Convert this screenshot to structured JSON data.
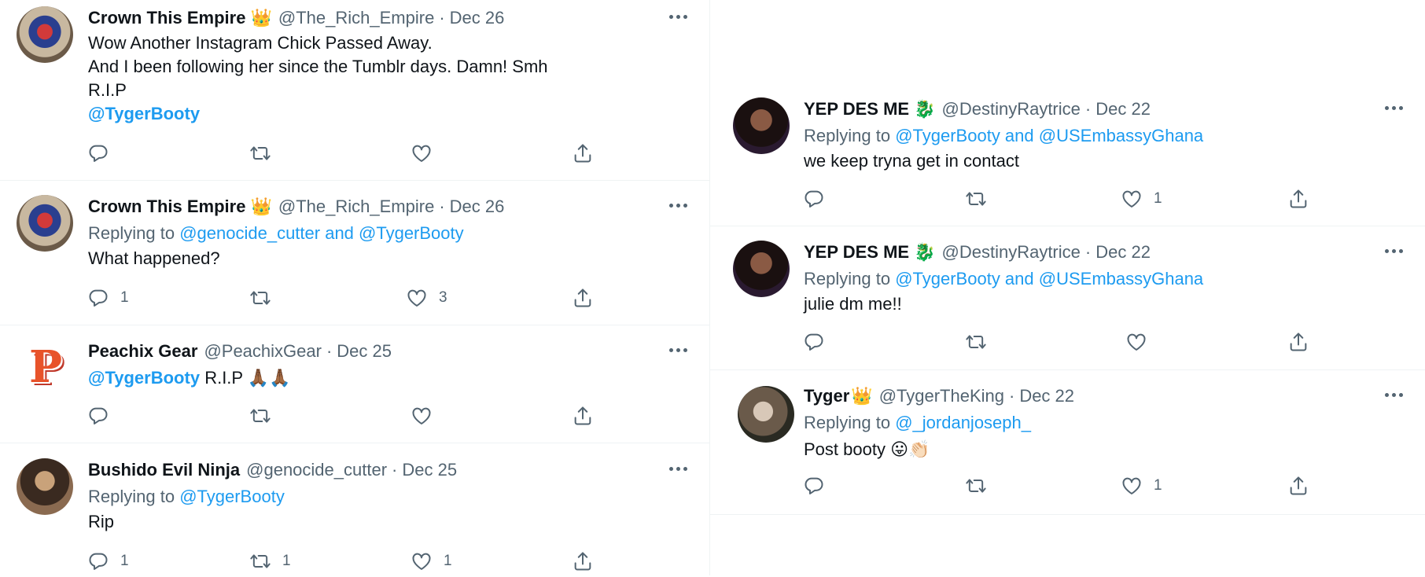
{
  "colors": {
    "link": "#1d9bf0",
    "muted": "#536471",
    "text": "#0f1419"
  },
  "left": {
    "t1": {
      "name": "Crown This Empire",
      "badge": "crown-emoji",
      "handle": "@The_Rich_Empire",
      "sep": "·",
      "date": "Dec 26",
      "lines": [
        "Wow Another Instagram Chick Passed Away.",
        "And I been following her since the Tumblr days. Damn! Smh",
        "R.I.P"
      ],
      "mention": "@TygerBooty",
      "counts": {
        "reply": "",
        "retweet": "",
        "like": ""
      }
    },
    "t2": {
      "name": "Crown This Empire",
      "badge": "crown-emoji",
      "handle": "@The_Rich_Empire",
      "sep": "·",
      "date": "Dec 26",
      "replying_prefix": "Replying to",
      "replying_to": "@genocide_cutter and @TygerBooty",
      "text": "What happened?",
      "counts": {
        "reply": "1",
        "retweet": "",
        "like": "3"
      }
    },
    "t3": {
      "name": "Peachix Gear",
      "handle": "@PeachixGear",
      "sep": "·",
      "date": "Dec 25",
      "mention": "@TygerBooty",
      "text": "R.I.P",
      "emoji": "🙏🏾🙏🏾",
      "counts": {
        "reply": "",
        "retweet": "",
        "like": ""
      }
    },
    "t4": {
      "name": "Bushido Evil Ninja",
      "handle": "@genocide_cutter",
      "sep": "·",
      "date": "Dec 25",
      "replying_prefix": "Replying to",
      "replying_to": "@TygerBooty",
      "text": "Rip",
      "counts": {
        "reply": "1",
        "retweet": "1",
        "like": "1"
      }
    }
  },
  "right": {
    "t5": {
      "name": "YEP DES ME",
      "badge": "dragon-emoji",
      "handle": "@DestinyRaytrice",
      "sep": "·",
      "date": "Dec 22",
      "replying_prefix": "Replying to",
      "replying_to": "@TygerBooty and @USEmbassyGhana",
      "text": "we keep tryna get in contact",
      "counts": {
        "reply": "",
        "retweet": "",
        "like": "1"
      }
    },
    "t6": {
      "name": "YEP DES ME",
      "badge": "dragon-emoji",
      "handle": "@DestinyRaytrice",
      "sep": "·",
      "date": "Dec 22",
      "replying_prefix": "Replying to",
      "replying_to": "@TygerBooty and @USEmbassyGhana",
      "text": "julie dm me!!",
      "counts": {
        "reply": "",
        "retweet": "",
        "like": ""
      }
    },
    "t7": {
      "name": "Tyger",
      "badge": "crown-emoji",
      "handle": "@TygerTheKing",
      "sep": "·",
      "date": "Dec 22",
      "replying_prefix": "Replying to",
      "replying_to": "@_jordanjoseph_",
      "text": "Post booty",
      "emoji": "😛👏🏻",
      "counts": {
        "reply": "",
        "retweet": "",
        "like": "1"
      }
    }
  }
}
